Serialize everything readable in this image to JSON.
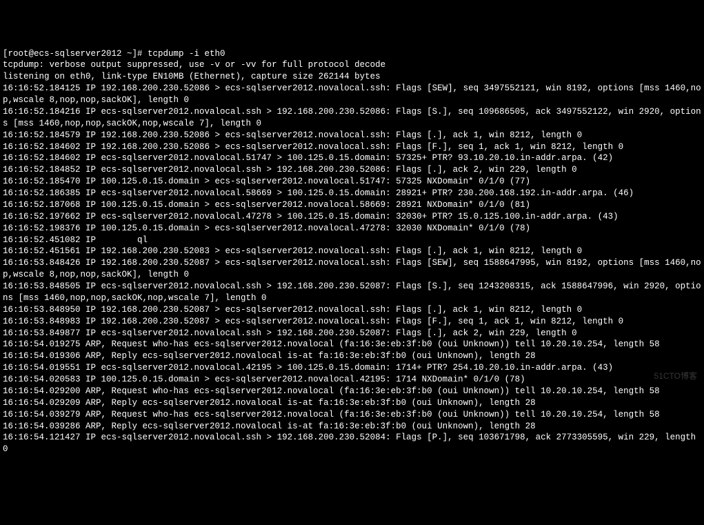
{
  "terminal": {
    "prompt": "[root@ecs-sqlserver2012 ~]# tcpdump -i eth0",
    "lines": [
      "tcpdump: verbose output suppressed, use -v or -vv for full protocol decode",
      "listening on eth0, link-type EN10MB (Ethernet), capture size 262144 bytes",
      "16:16:52.184125 IP 192.168.200.230.52086 > ecs-sqlserver2012.novalocal.ssh: Flags [SEW], seq 3497552121, win 8192, options [mss 1460,nop,wscale 8,nop,nop,sackOK], length 0",
      "16:16:52.184216 IP ecs-sqlserver2012.novalocal.ssh > 192.168.200.230.52086: Flags [S.], seq 109686505, ack 3497552122, win 2920, options [mss 1460,nop,nop,sackOK,nop,wscale 7], length 0",
      "16:16:52.184579 IP 192.168.200.230.52086 > ecs-sqlserver2012.novalocal.ssh: Flags [.], ack 1, win 8212, length 0",
      "16:16:52.184602 IP 192.168.200.230.52086 > ecs-sqlserver2012.novalocal.ssh: Flags [F.], seq 1, ack 1, win 8212, length 0",
      "16:16:52.184602 IP ecs-sqlserver2012.novalocal.51747 > 100.125.0.15.domain: 57325+ PTR? 93.10.20.10.in-addr.arpa. (42)",
      "16:16:52.184852 IP ecs-sqlserver2012.novalocal.ssh > 192.168.200.230.52086: Flags [.], ack 2, win 229, length 0",
      "16:16:52.185470 IP 100.125.0.15.domain > ecs-sqlserver2012.novalocal.51747: 57325 NXDomain* 0/1/0 (77)",
      "16:16:52.186385 IP ecs-sqlserver2012.novalocal.58669 > 100.125.0.15.domain: 28921+ PTR? 230.200.168.192.in-addr.arpa. (46)",
      "16:16:52.187068 IP 100.125.0.15.domain > ecs-sqlserver2012.novalocal.58669: 28921 NXDomain* 0/1/0 (81)",
      "16:16:52.197662 IP ecs-sqlserver2012.novalocal.47278 > 100.125.0.15.domain: 32030+ PTR? 15.0.125.100.in-addr.arpa. (43)",
      "16:16:52.198376 IP 100.125.0.15.domain > ecs-sqlserver2012.novalocal.47278: 32030 NXDomain* 0/1/0 (78)",
      "16:16:52.451082 IP        ql",
      "16:16:52.451561 IP 192.168.200.230.52083 > ecs-sqlserver2012.novalocal.ssh: Flags [.], ack 1, win 8212, length 0",
      "16:16:53.848426 IP 192.168.200.230.52087 > ecs-sqlserver2012.novalocal.ssh: Flags [SEW], seq 1588647995, win 8192, options [mss 1460,nop,wscale 8,nop,nop,sackOK], length 0",
      "16:16:53.848505 IP ecs-sqlserver2012.novalocal.ssh > 192.168.200.230.52087: Flags [S.], seq 1243208315, ack 1588647996, win 2920, options [mss 1460,nop,nop,sackOK,nop,wscale 7], length 0",
      "16:16:53.848950 IP 192.168.200.230.52087 > ecs-sqlserver2012.novalocal.ssh: Flags [.], ack 1, win 8212, length 0",
      "16:16:53.848983 IP 192.168.200.230.52087 > ecs-sqlserver2012.novalocal.ssh: Flags [F.], seq 1, ack 1, win 8212, length 0",
      "16:16:53.849877 IP ecs-sqlserver2012.novalocal.ssh > 192.168.200.230.52087: Flags [.], ack 2, win 229, length 0",
      "16:16:54.019275 ARP, Request who-has ecs-sqlserver2012.novalocal (fa:16:3e:eb:3f:b0 (oui Unknown)) tell 10.20.10.254, length 58",
      "16:16:54.019306 ARP, Reply ecs-sqlserver2012.novalocal is-at fa:16:3e:eb:3f:b0 (oui Unknown), length 28",
      "16:16:54.019551 IP ecs-sqlserver2012.novalocal.42195 > 100.125.0.15.domain: 1714+ PTR? 254.10.20.10.in-addr.arpa. (43)",
      "16:16:54.020583 IP 100.125.0.15.domain > ecs-sqlserver2012.novalocal.42195: 1714 NXDomain* 0/1/0 (78)",
      "16:16:54.029200 ARP, Request who-has ecs-sqlserver2012.novalocal (fa:16:3e:eb:3f:b0 (oui Unknown)) tell 10.20.10.254, length 58",
      "16:16:54.029209 ARP, Reply ecs-sqlserver2012.novalocal is-at fa:16:3e:eb:3f:b0 (oui Unknown), length 28",
      "16:16:54.039279 ARP, Request who-has ecs-sqlserver2012.novalocal (fa:16:3e:eb:3f:b0 (oui Unknown)) tell 10.20.10.254, length 58",
      "16:16:54.039286 ARP, Reply ecs-sqlserver2012.novalocal is-at fa:16:3e:eb:3f:b0 (oui Unknown), length 28",
      "16:16:54.121427 IP ecs-sqlserver2012.novalocal.ssh > 192.168.200.230.52084: Flags [P.], seq 103671798, ack 2773305595, win 229, length 0"
    ]
  },
  "watermark": "51CTO博客"
}
